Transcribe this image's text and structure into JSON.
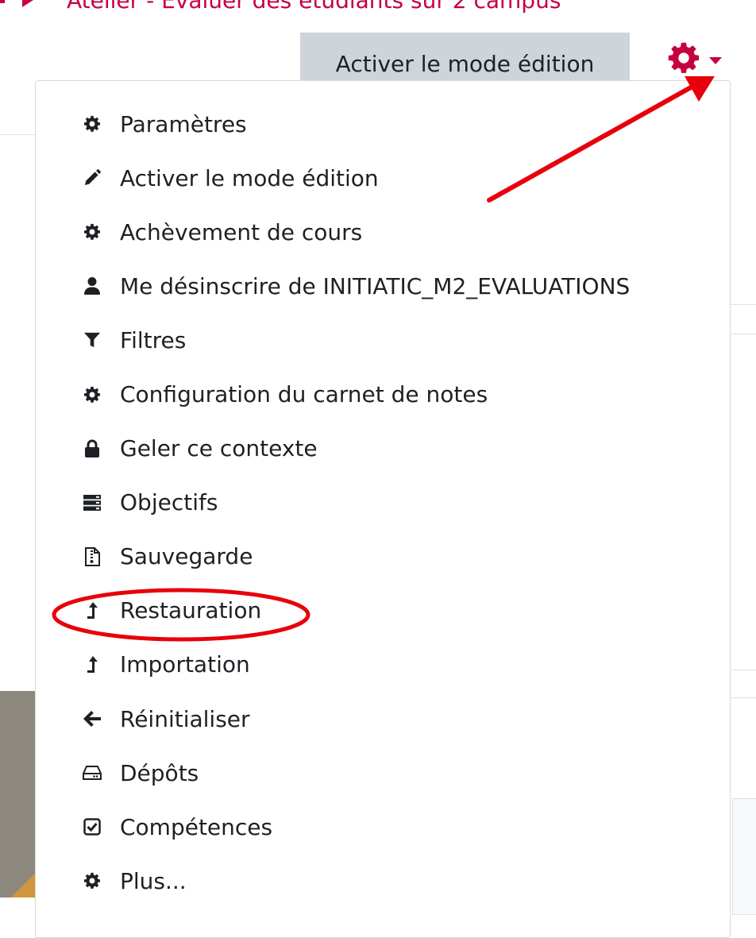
{
  "breadcrumb": {
    "current": "Atelier - Evaluer des étudiants sur 2 campus"
  },
  "header": {
    "edit_mode_button": "Activer le mode édition"
  },
  "colors": {
    "accent": "#c6003e",
    "annotation": "#e8000b",
    "button_bg": "#ced4da",
    "text": "#1d2125"
  },
  "menu": {
    "items": [
      {
        "label": "Paramètres",
        "icon": "gear-icon"
      },
      {
        "label": "Activer le mode édition",
        "icon": "pencil-icon"
      },
      {
        "label": "Achèvement de cours",
        "icon": "gear-icon"
      },
      {
        "label": "Me désinscrire de INITIATIC_M2_EVALUATIONS",
        "icon": "user-icon"
      },
      {
        "label": "Filtres",
        "icon": "filter-icon"
      },
      {
        "label": "Configuration du carnet de notes",
        "icon": "gear-icon"
      },
      {
        "label": "Geler ce contexte",
        "icon": "lock-icon"
      },
      {
        "label": "Objectifs",
        "icon": "server-icon"
      },
      {
        "label": "Sauvegarde",
        "icon": "file-archive-icon"
      },
      {
        "label": "Restauration",
        "icon": "level-up-icon"
      },
      {
        "label": "Importation",
        "icon": "level-up-icon"
      },
      {
        "label": "Réinitialiser",
        "icon": "arrow-left-icon"
      },
      {
        "label": "Dépôts",
        "icon": "hdd-icon"
      },
      {
        "label": "Compétences",
        "icon": "check-square-icon"
      },
      {
        "label": "Plus...",
        "icon": "gear-icon"
      }
    ]
  },
  "annotations": {
    "arrow_target": "gear-menu-toggle",
    "highlighted_item": "Restauration"
  }
}
